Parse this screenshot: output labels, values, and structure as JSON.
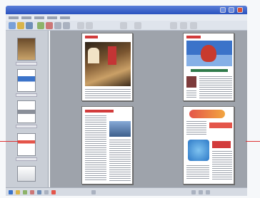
{
  "window": {
    "title": ""
  },
  "menubar": {
    "items": []
  },
  "colors": {
    "accent": "#2a52be",
    "workspace": "#9ea3ab",
    "red_marker": "#d33333"
  },
  "icons": [
    "app-icon",
    "minimize-icon",
    "maximize-icon",
    "close-icon"
  ]
}
